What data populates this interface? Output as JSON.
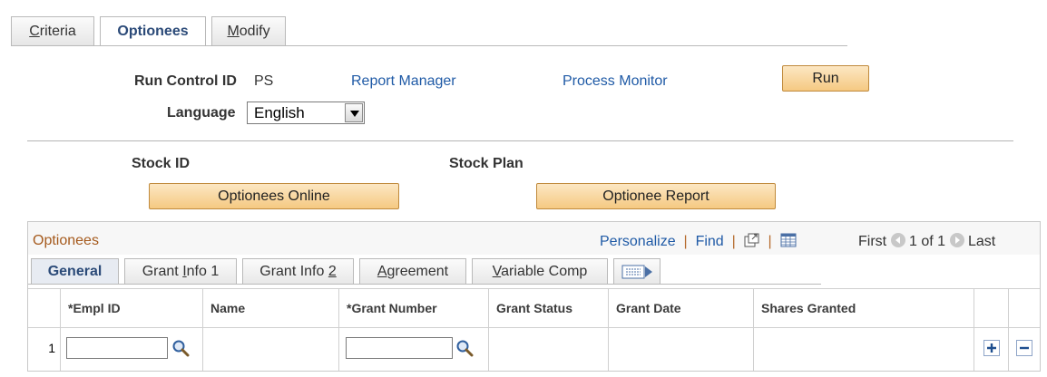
{
  "tabs": [
    {
      "pre": "",
      "u": "C",
      "post": "riteria"
    },
    {
      "pre": "Optionees",
      "u": "",
      "post": ""
    },
    {
      "pre": "",
      "u": "M",
      "post": "odify"
    }
  ],
  "run_control": {
    "label": "Run Control ID",
    "value": "PS",
    "report_manager": "Report Manager",
    "process_monitor": "Process Monitor",
    "run_button": "Run"
  },
  "language": {
    "label": "Language",
    "selected": "English"
  },
  "stock": {
    "stock_id_label": "Stock ID",
    "stock_plan_label": "Stock Plan",
    "optionees_online_button": "Optionees Online",
    "optionee_report_button": "Optionee Report"
  },
  "grid": {
    "title": "Optionees",
    "personalize": "Personalize",
    "find": "Find",
    "first": "First",
    "pager": "1 of 1",
    "last": "Last",
    "subtabs": [
      {
        "pre": "General",
        "u": "",
        "post": ""
      },
      {
        "pre": "Grant ",
        "u": "I",
        "post": "nfo 1"
      },
      {
        "pre": "Grant Info ",
        "u": "2",
        "post": ""
      },
      {
        "pre": "",
        "u": "A",
        "post": "greement"
      },
      {
        "pre": "",
        "u": "V",
        "post": "ariable Comp"
      }
    ],
    "columns": [
      "*Empl ID",
      "Name",
      "*Grant Number",
      "Grant Status",
      "Grant Date",
      "Shares Granted"
    ],
    "rows": [
      {
        "num": "1",
        "empl_id": "",
        "name": "",
        "grant_number": "",
        "grant_status": "",
        "grant_date": "",
        "shares_granted": ""
      }
    ]
  }
}
